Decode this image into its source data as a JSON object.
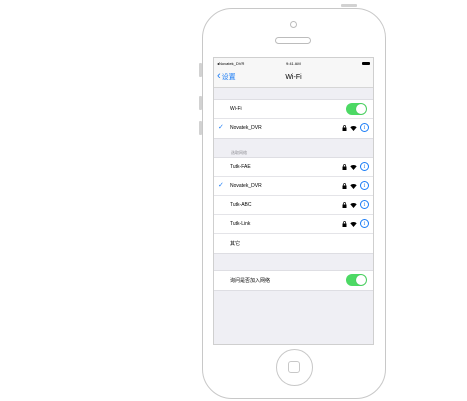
{
  "status_bar": {
    "carrier": "◂Novatek_DVR",
    "time": "9:41 AM"
  },
  "nav": {
    "back_label": "设置",
    "title": "Wi-Fi"
  },
  "wifi_section": {
    "toggle_label": "Wi-Fi",
    "toggle_on": true,
    "connected_network": "Novatek_DVR"
  },
  "choose_network": {
    "header": "选取网络",
    "networks": [
      {
        "name": "Tutk-FAE",
        "checked": false,
        "locked": true
      },
      {
        "name": "Novatek_DVR",
        "checked": true,
        "locked": true
      },
      {
        "name": "Tutk-ABC",
        "checked": false,
        "locked": true
      },
      {
        "name": "Tutk-Link",
        "checked": false,
        "locked": true
      }
    ],
    "other_label": "其它"
  },
  "ask_join": {
    "label": "询问是否加入网络",
    "toggle_on": true
  },
  "colors": {
    "accent": "#1a7cf6",
    "toggle_on": "#4cd964",
    "background": "#efeff4"
  },
  "icons": {
    "check": "checkmark-icon",
    "lock": "lock-icon",
    "wifi": "wifi-signal-icon",
    "info": "info-icon"
  }
}
